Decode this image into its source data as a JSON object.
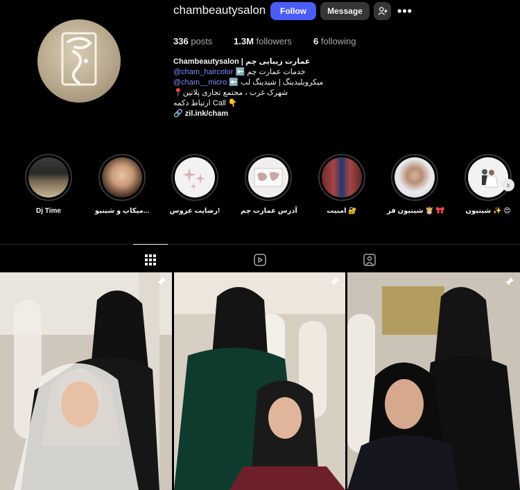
{
  "profile": {
    "username": "chambeautysalon",
    "follow_label": "Follow",
    "message_label": "Message",
    "more_label": "•••",
    "avatar_icon": "salon-logo",
    "stats": {
      "posts_count": "336",
      "posts_label": "posts",
      "followers_count": "1.3M",
      "followers_label": "followers",
      "following_count": "6",
      "following_label": "following"
    }
  },
  "bio": {
    "name": "Chambeautysalon | عمارت زیبایی چم",
    "line1_handle": "@cham_haircolor",
    "line1_text": "⬅️ خدمات عمارت چم",
    "line2_handle": "@cham__micro",
    "line2_text": "⬅️ میکروبلیدینگ | شیدینگ لب",
    "line3": "📍شهرک غرب ، مجتمع تجاری پلاتین",
    "line4": "ارتباط دکمه Call 👇",
    "url": "zil.ink/cham"
  },
  "highlights": [
    {
      "label": "Dj Time"
    },
    {
      "label": "میکاپ و شینیو..."
    },
    {
      "label": "رضایت عروس!"
    },
    {
      "label": "آدرس عمارت چم"
    },
    {
      "label": "امنیت 🔐"
    },
    {
      "label": "شینیون فر 👸🏻 🎀"
    },
    {
      "label": "شینیون ✨ 😍"
    }
  ],
  "tabs": [
    {
      "icon": "grid-icon",
      "active": true
    },
    {
      "icon": "reels-icon",
      "active": false
    },
    {
      "icon": "tagged-icon",
      "active": false
    }
  ],
  "colors": {
    "background": "#000000",
    "follow_button": "#4a5df9",
    "secondary_button": "#363636",
    "link": "#7b8cff",
    "muted_text": "#a8a8a8"
  }
}
